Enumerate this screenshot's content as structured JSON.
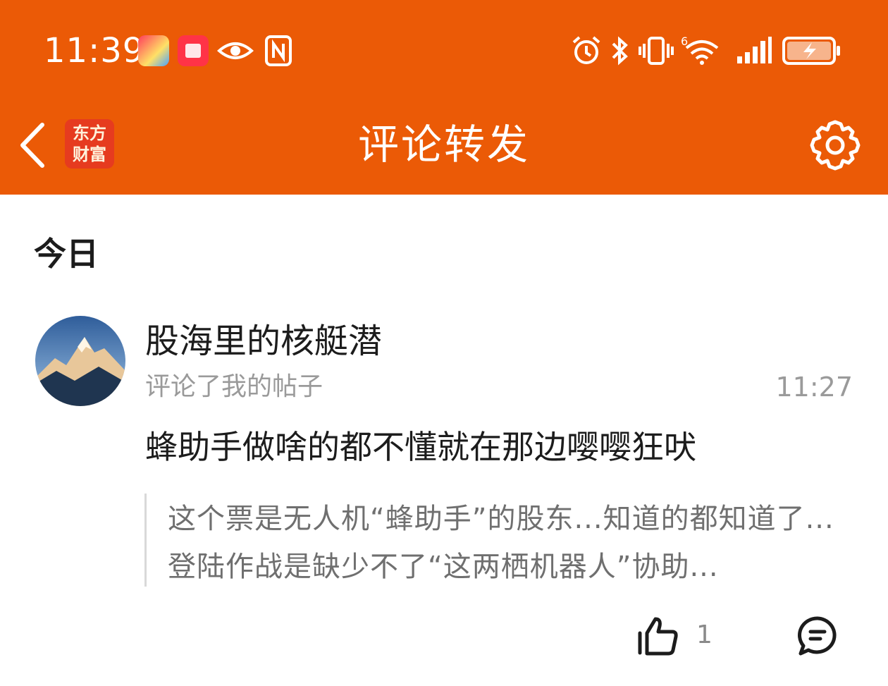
{
  "status_bar": {
    "time": "11:39",
    "notification_icons": [
      "shopping-app-icon",
      "reader-app-icon",
      "eye-icon",
      "nfc-icon"
    ],
    "system_icons": [
      "alarm-icon",
      "bluetooth-icon",
      "vibrate-icon",
      "wifi-6-icon",
      "signal-icon",
      "battery-charging-icon"
    ]
  },
  "header": {
    "logo_line1": "东方",
    "logo_line2": "财富",
    "title": "评论转发"
  },
  "section_title": "今日",
  "comment": {
    "username": "股海里的核艇潜",
    "action": "评论了我的帖子",
    "time": "11:27",
    "text": "蜂助手做啥的都不懂就在那边嘤嘤狂吠",
    "quoted_post": "这个票是无人机“蜂助手”的股东...知道的都知道了...登陆作战是缺少不了“这两栖机器人”协助...",
    "like_count": "1"
  },
  "colors": {
    "brand_orange": "#eb5a06",
    "logo_red": "#e63b1f",
    "text_primary": "#1c1c1c",
    "text_secondary": "#9a9a9a"
  }
}
